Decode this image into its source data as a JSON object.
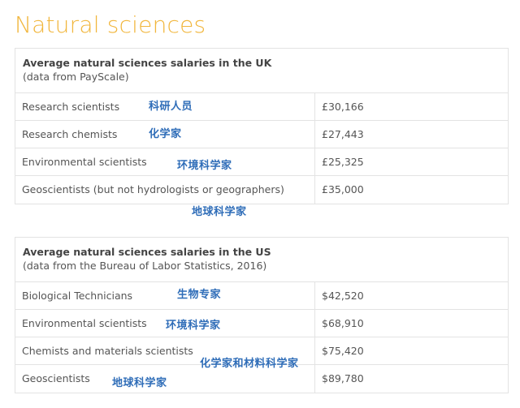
{
  "section_title": "Natural sciences",
  "annotation_color": "#2f6db8",
  "accent_color": "#f1b63c",
  "uk_table": {
    "title": "Average natural sciences salaries in the UK",
    "source": "(data from PayScale)",
    "rows": [
      {
        "job": "Research scientists",
        "salary": "£30,166",
        "note": "科研人员"
      },
      {
        "job": "Research chemists",
        "salary": "£27,443",
        "note": "化学家"
      },
      {
        "job": "Environmental scientists",
        "salary": "£25,325",
        "note": "环境科学家"
      },
      {
        "job": "Geoscientists (but not hydrologists or geographers)",
        "salary": "£35,000",
        "note": "地球科学家"
      }
    ]
  },
  "us_table": {
    "title": "Average natural sciences salaries in the US",
    "source": "(data from the Bureau of Labor Statistics, 2016)",
    "rows": [
      {
        "job": "Biological Technicians",
        "salary": "$42,520",
        "note": "生物专家"
      },
      {
        "job": "Environmental scientists",
        "salary": "$68,910",
        "note": "环境科学家"
      },
      {
        "job": "Chemists and materials scientists",
        "salary": "$75,420",
        "note": "化学家和材料科学家"
      },
      {
        "job": "Geoscientists",
        "salary": "$89,780",
        "note": "地球科学家"
      }
    ]
  }
}
